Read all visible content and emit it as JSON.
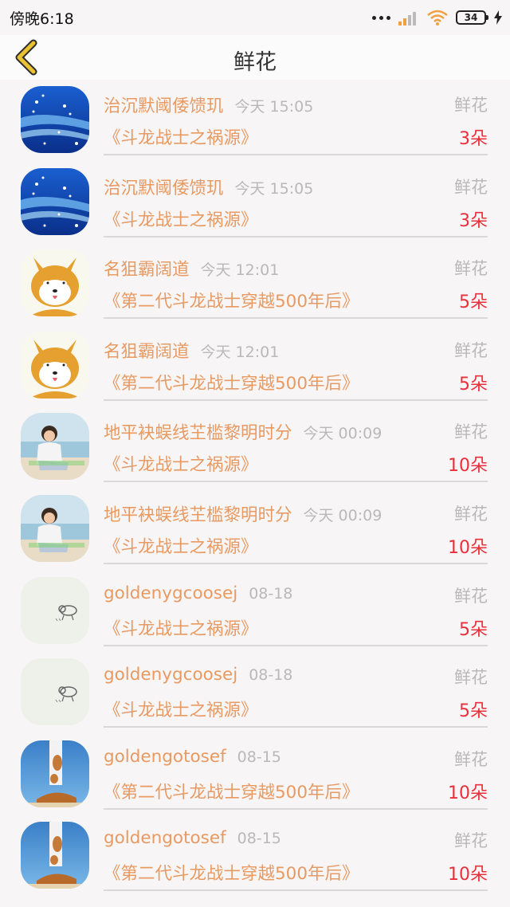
{
  "status_bar": {
    "time": "傍晚6:18",
    "battery": "34"
  },
  "nav": {
    "title": "鲜花"
  },
  "colors": {
    "accent_text": "#e89a62",
    "count_text": "#e8303c",
    "muted_text": "#b9b9b9",
    "back_icon": "#e8c230"
  },
  "rows": [
    {
      "avatar": "snowflake-wave",
      "name": "治沉默阈倭馈玑",
      "time": "今天 15:05",
      "gift": "鲜花",
      "book": "《斗龙战士之祸源》",
      "count": "3朵"
    },
    {
      "avatar": "snowflake-wave",
      "name": "治沉默阈倭馈玑",
      "time": "今天 15:05",
      "gift": "鲜花",
      "book": "《斗龙战士之祸源》",
      "count": "3朵"
    },
    {
      "avatar": "shiba-dog",
      "name": "名狙霸阔道",
      "time": "今天 12:01",
      "gift": "鲜花",
      "book": "《第二代斗龙战士穿越500年后》",
      "count": "5朵"
    },
    {
      "avatar": "shiba-dog",
      "name": "名狙霸阔道",
      "time": "今天 12:01",
      "gift": "鲜花",
      "book": "《第二代斗龙战士穿越500年后》",
      "count": "5朵"
    },
    {
      "avatar": "beach-person",
      "name": "地平袂蜈线芏槛黎明时分",
      "time": "今天 00:09",
      "gift": "鲜花",
      "book": "《斗龙战士之祸源》",
      "count": "10朵"
    },
    {
      "avatar": "beach-person",
      "name": "地平袂蜈线芏槛黎明时分",
      "time": "今天 00:09",
      "gift": "鲜花",
      "book": "《斗龙战士之祸源》",
      "count": "10朵"
    },
    {
      "avatar": "sketch-animal",
      "name": "goldenygcoosej",
      "time": "08-18",
      "gift": "鲜花",
      "book": "《斗龙战士之祸源》",
      "count": "5朵"
    },
    {
      "avatar": "sketch-animal",
      "name": "goldenygcoosej",
      "time": "08-18",
      "gift": "鲜花",
      "book": "《斗龙战士之祸源》",
      "count": "5朵"
    },
    {
      "avatar": "upside-down-dog",
      "name": "goldengotosef",
      "time": "08-15",
      "gift": "鲜花",
      "book": "《第二代斗龙战士穿越500年后》",
      "count": "10朵"
    },
    {
      "avatar": "upside-down-dog",
      "name": "goldengotosef",
      "time": "08-15",
      "gift": "鲜花",
      "book": "《第二代斗龙战士穿越500年后》",
      "count": "10朵"
    }
  ]
}
